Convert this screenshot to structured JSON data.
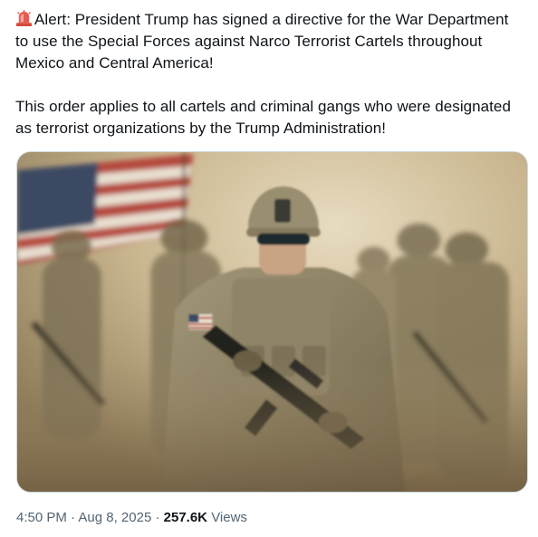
{
  "tweet": {
    "alert_icon": "police-car-light-icon",
    "paragraph1": "Alert: President Trump has signed a directive for the War Department to use the Special Forces against Narco Terrorist Cartels throughout Mexico and Central America!",
    "paragraph2": "This order applies to all cartels and criminal gangs who were designated as terrorist organizations by the Trump Administration!",
    "time": "4:50 PM",
    "separator": "·",
    "date": "Aug 8, 2025",
    "views_count": "257.6K",
    "views_label": "Views"
  },
  "colors": {
    "text": "#0f1419",
    "secondary_text": "#536471",
    "border": "#cfd9de",
    "alert_red": "#e0453a"
  }
}
